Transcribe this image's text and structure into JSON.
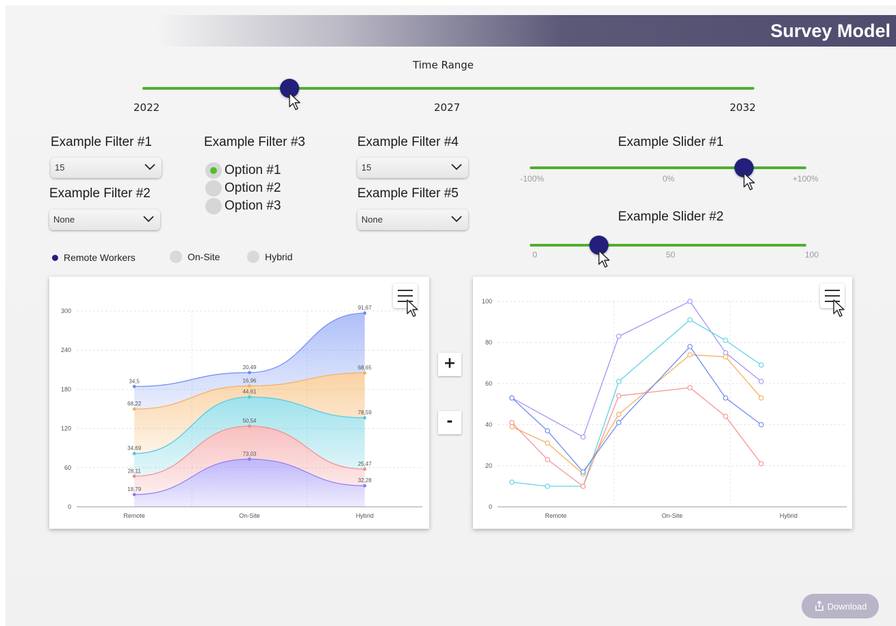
{
  "app": {
    "title": "Survey Model"
  },
  "time_range": {
    "label": "Time Range",
    "ticks": [
      "2022",
      "2027",
      "2032"
    ],
    "value_fraction": 0.24
  },
  "filters": {
    "f1": {
      "title": "Example Filter #1",
      "value": "15"
    },
    "f2": {
      "title": "Example Filter #2",
      "value": "None"
    },
    "f3": {
      "title": "Example Filter #3",
      "options": [
        "Option #1",
        "Option #2",
        "Option #3"
      ],
      "selected": 0
    },
    "f4": {
      "title": "Example Filter #4",
      "value": "15"
    },
    "f5": {
      "title": "Example Filter #5",
      "value": "None"
    }
  },
  "slider1": {
    "title": "Example Slider #1",
    "ticks": [
      "-100%",
      "0%",
      "+100%"
    ],
    "value_percent": 55
  },
  "slider2": {
    "title": "Example Slider #2",
    "ticks": [
      "0",
      "50",
      "100"
    ],
    "value": 25
  },
  "legend": [
    {
      "label": "Remote Workers",
      "active": true,
      "color": "#231f7a"
    },
    {
      "label": "On-Site",
      "active": false,
      "color": "#d9d9d9"
    },
    {
      "label": "Hybrid",
      "active": false,
      "color": "#d9d9d9"
    }
  ],
  "icons": {
    "menu": "hamburger-menu-icon",
    "cursor": "mouse-pointer-icon",
    "download": "share-upload-icon",
    "chevron": "chevron-down-icon"
  },
  "zoom": {
    "plus": "+",
    "minus": "-"
  },
  "download": {
    "label": "Download"
  },
  "chart_data": [
    {
      "type": "area",
      "stacked": true,
      "categories": [
        "Remote",
        "On-Site",
        "Hybrid"
      ],
      "ylim": [
        0,
        300
      ],
      "yticks": [
        "0",
        "60",
        "120",
        "180",
        "240",
        "300"
      ],
      "grid": true,
      "series": [
        {
          "values": [
            18.79,
            73.03,
            32.28
          ],
          "labels": [
            "18,79",
            "73,03",
            "32,28"
          ],
          "color": "#8b7cf6"
        },
        {
          "values": [
            28.11,
            50.54,
            25.47
          ],
          "labels": [
            "28,11",
            "50,54",
            "25,47"
          ],
          "color": "#f28b8b"
        },
        {
          "values": [
            34.69,
            44.61,
            78.59
          ],
          "labels": [
            "34,69",
            "44,61",
            "78,59"
          ],
          "color": "#4fc9dc"
        },
        {
          "values": [
            68.22,
            16.96,
            68.65
          ],
          "labels": [
            "68,22",
            "16,96",
            "68,65"
          ],
          "color": "#f5ae5a"
        },
        {
          "values": [
            34.5,
            20.49,
            91.67
          ],
          "labels": [
            "34,5",
            "20,49",
            "91,67"
          ],
          "color": "#6d8cf2"
        }
      ]
    },
    {
      "type": "line",
      "categories": [
        "Remote",
        "On-Site",
        "Hybrid"
      ],
      "x": [
        0.5,
        1,
        1.5,
        2,
        2.5,
        3,
        3.5,
        4,
        4.5,
        5
      ],
      "xlim": [
        0.3,
        5.2
      ],
      "ylim": [
        0,
        100
      ],
      "yticks": [
        "0",
        "20",
        "40",
        "60",
        "80",
        "100"
      ],
      "grid": true,
      "series": [
        {
          "values": [
            53,
            null,
            34,
            83,
            null,
            100,
            75,
            61,
            null,
            null
          ],
          "color": "#a894f5"
        },
        {
          "values": [
            12,
            10,
            10,
            61,
            null,
            91,
            81,
            69,
            null,
            null
          ],
          "color": "#5fd3e3"
        },
        {
          "values": [
            39,
            31,
            16,
            45,
            null,
            74,
            73,
            53,
            null,
            null
          ],
          "color": "#f5ae5a"
        },
        {
          "values": [
            41,
            23,
            10,
            54,
            null,
            58,
            44,
            21,
            null,
            null
          ],
          "color": "#f59494"
        },
        {
          "values": [
            53,
            37,
            17,
            41,
            null,
            78,
            53,
            40,
            null,
            null
          ],
          "color": "#6d8cf2"
        }
      ]
    }
  ]
}
